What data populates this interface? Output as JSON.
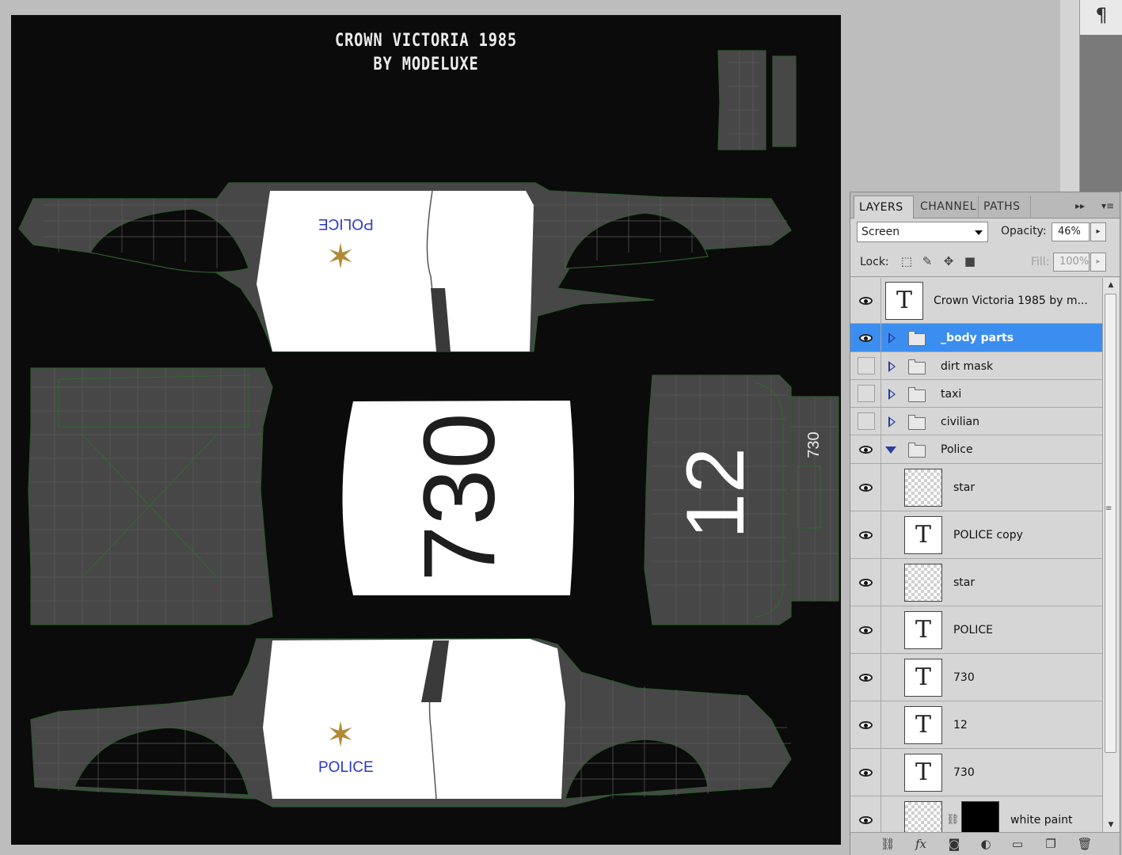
{
  "document": {
    "texture_title_line1": "CROWN VICTORIA 1985",
    "texture_title_line2": "BY MODELUXE",
    "door_text_top": "POLICE",
    "door_text_bottom": "POLICE",
    "roof_number": "730",
    "trunk_number": "12",
    "rear_small_number": "730"
  },
  "toolstrip": {
    "paragraph_icon": "¶"
  },
  "panel": {
    "tabs": [
      "LAYERS",
      "CHANNEL",
      "PATHS"
    ],
    "tab_menu_glyph": "▸▸",
    "panel_menu_glyph": "▾≡",
    "blend_mode": "Screen",
    "opacity_label": "Opacity:",
    "opacity_value": "46%",
    "lock_label": "Lock:",
    "fill_label": "Fill:",
    "fill_value": "100%",
    "layers": [
      {
        "name": "Crown Victoria 1985 by m...",
        "kind": "text",
        "visible": true
      },
      {
        "name": "_body parts",
        "kind": "group",
        "visible": true,
        "selected": true
      },
      {
        "name": "dirt mask",
        "kind": "group",
        "visible": false
      },
      {
        "name": "taxi",
        "kind": "group",
        "visible": false
      },
      {
        "name": "civilian",
        "kind": "group",
        "visible": false
      },
      {
        "name": "Police",
        "kind": "group-open",
        "visible": true
      },
      {
        "name": "star",
        "kind": "raster",
        "visible": true
      },
      {
        "name": "POLICE copy",
        "kind": "text",
        "visible": true
      },
      {
        "name": "star",
        "kind": "raster",
        "visible": true
      },
      {
        "name": "POLICE",
        "kind": "text",
        "visible": true
      },
      {
        "name": "730",
        "kind": "text",
        "visible": true
      },
      {
        "name": "12",
        "kind": "text",
        "visible": true
      },
      {
        "name": "730",
        "kind": "text",
        "visible": true
      },
      {
        "name": "white paint",
        "kind": "masked",
        "visible": true
      }
    ],
    "bottom_icons": [
      "link-icon",
      "fx-icon",
      "mask-icon",
      "adjustment-icon",
      "new-group-icon",
      "new-layer-icon",
      "trash-icon"
    ]
  },
  "colors": {
    "selection": "#3b8ef0",
    "canvas_bg": "#0b0b0b",
    "police_text": "#2a37c9"
  }
}
